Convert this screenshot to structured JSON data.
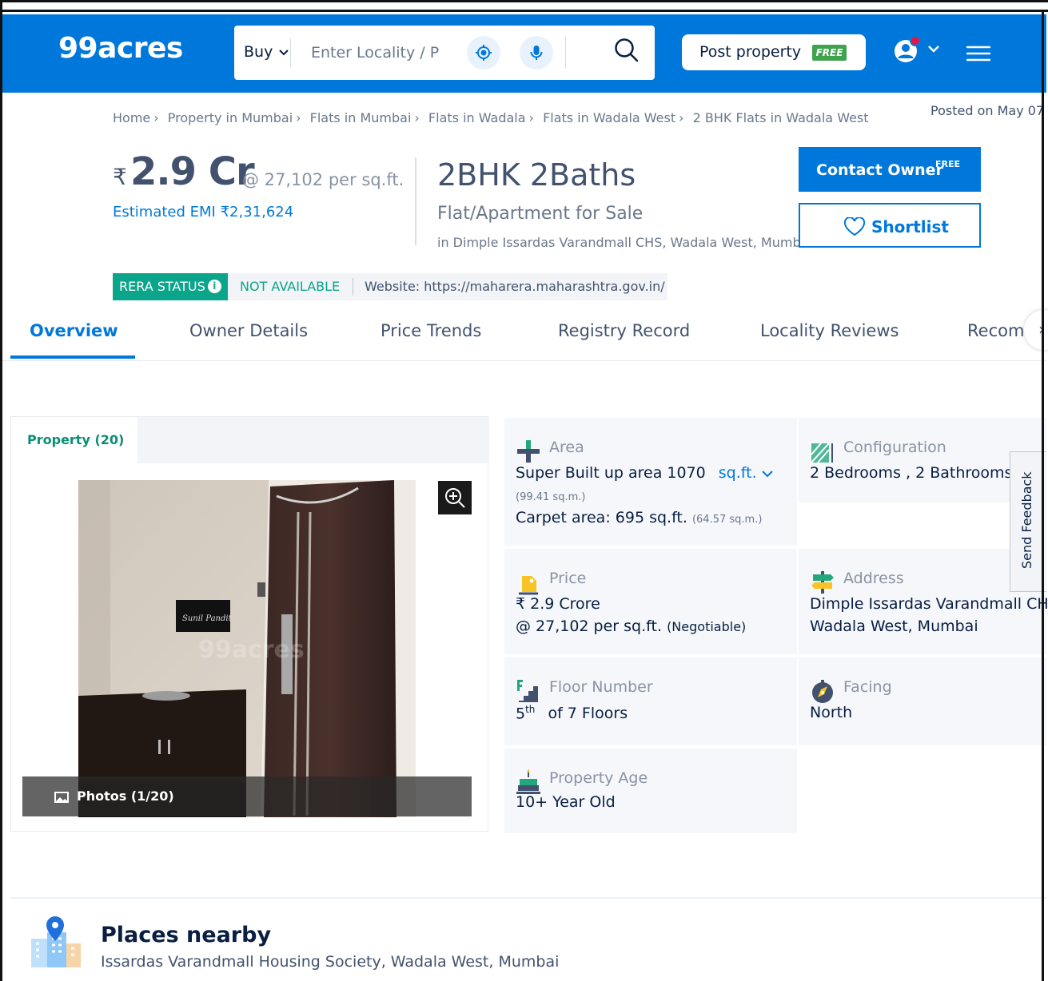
{
  "header": {
    "logo": "99acres",
    "search": {
      "buy_label": "Buy",
      "placeholder": "Enter Locality / P"
    },
    "post_property": {
      "label": "Post property",
      "badge": "FREE"
    }
  },
  "breadcrumb": [
    "Home",
    "Property in Mumbai",
    "Flats in Mumbai",
    "Flats in Wadala",
    "Flats in Wadala West",
    "2 BHK Flats in Wadala West"
  ],
  "posted": "Posted on May 07",
  "listing": {
    "rupee": "₹",
    "price": "2.9 Cr",
    "per_sqft": "@ 27,102 per sq.ft.",
    "emi": "Estimated EMI ₹2,31,624",
    "config": "2BHK 2Baths",
    "type": "Flat/Apartment for Sale",
    "location": "in Dimple Issardas Varandmall CHS, Wadala West, Mumbai"
  },
  "actions": {
    "contact": {
      "label": "Contact Owner",
      "badge": "FREE"
    },
    "shortlist": {
      "label": "Shortlist"
    }
  },
  "rera": {
    "status_label": "RERA STATUS",
    "info": "i",
    "status_value": "NOT AVAILABLE",
    "website": "Website: https://maharera.maharashtra.gov.in/"
  },
  "tabs": [
    {
      "label": "Overview"
    },
    {
      "label": "Owner Details"
    },
    {
      "label": "Price Trends"
    },
    {
      "label": "Registry Record"
    },
    {
      "label": "Locality Reviews"
    },
    {
      "label": "Recom..."
    }
  ],
  "tab_next": "›",
  "photos": {
    "tab_label": "Property (20)",
    "count_label": "Photos (1/20)",
    "watermark": "99acres"
  },
  "details": {
    "area": {
      "label": "Area",
      "super": "Super Built up area 1070",
      "unit": "sq.ft.",
      "super_sqm": "(99.41 sq.m.)",
      "carpet": "Carpet area: 695 sq.ft.",
      "carpet_sqm": "(64.57 sq.m.)"
    },
    "configuration": {
      "label": "Configuration",
      "value": "2 Bedrooms , 2 Bathrooms"
    },
    "price": {
      "label": "Price",
      "value": "₹ 2.9 Crore",
      "per_sqft": "@ 27,102 per sq.ft.",
      "note": "(Negotiable)"
    },
    "address": {
      "label": "Address",
      "line1": "Dimple Issardas Varandmall CHS,",
      "line2": "Wadala West, Mumbai"
    },
    "floor": {
      "label": "Floor Number",
      "floor": "5",
      "suffix": "th",
      "of": "of 7 Floors"
    },
    "facing": {
      "label": "Facing",
      "value": "North"
    },
    "age": {
      "label": "Property Age",
      "value": "10+ Year Old"
    }
  },
  "feedback": "Send Feedback",
  "places": {
    "title": "Places nearby",
    "subtitle": "Issardas Varandmall Housing Society, Wadala West, Mumbai"
  }
}
